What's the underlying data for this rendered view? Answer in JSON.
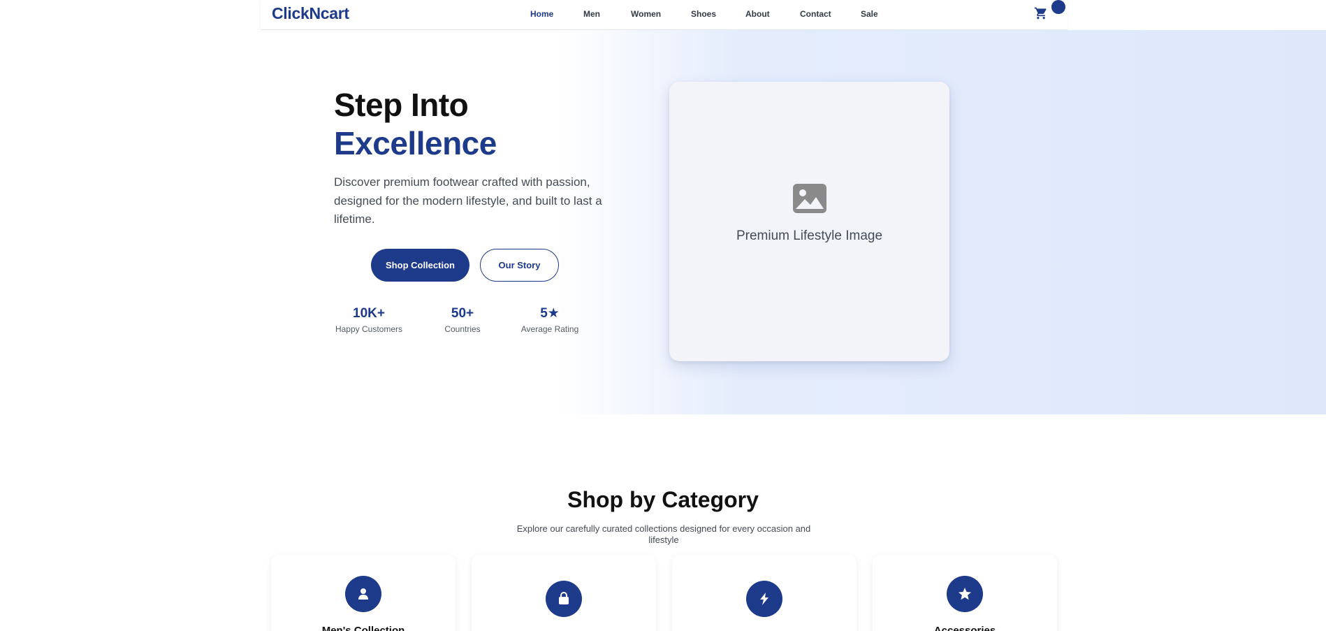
{
  "brand": {
    "logo": "ClickNcart",
    "primary_color": "#1e3a8a"
  },
  "nav": {
    "items": [
      {
        "label": "Home",
        "active": true
      },
      {
        "label": "Men"
      },
      {
        "label": "Women"
      },
      {
        "label": "Shoes"
      },
      {
        "label": "About"
      },
      {
        "label": "Contact"
      },
      {
        "label": "Sale"
      }
    ],
    "cart_icon": "shopping-cart-icon"
  },
  "hero": {
    "title_line1": "Step Into",
    "title_line2": "Excellence",
    "description": "Discover premium footwear crafted with passion, designed for the modern lifestyle, and built to last a lifetime.",
    "primary_button": "Shop Collection",
    "secondary_button": "Our Story",
    "stats": [
      {
        "value": "10K+",
        "label": "Happy Customers"
      },
      {
        "value": "50+",
        "label": "Countries"
      },
      {
        "value": "5★",
        "label": "Average Rating"
      }
    ],
    "image_icon": "image-icon",
    "image_caption": "Premium Lifestyle Image"
  },
  "categories": {
    "title": "Shop by Category",
    "subtitle": "Explore our carefully curated collections designed for every occasion and lifestyle",
    "items": [
      {
        "name": "Men's Collection",
        "icon": "user-icon"
      },
      {
        "name": "",
        "icon": "shopping-bag-icon"
      },
      {
        "name": "",
        "icon": "lightning-bolt-icon"
      },
      {
        "name": "Accessories",
        "icon": "star-icon"
      }
    ]
  }
}
